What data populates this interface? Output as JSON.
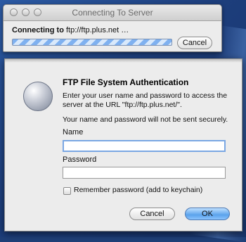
{
  "connecting_window": {
    "title": "Connecting To Server",
    "status_prefix": "Connecting to",
    "status_url": "ftp://ftp.plus.net …",
    "cancel_label": "Cancel"
  },
  "auth_dialog": {
    "title": "FTP File System Authentication",
    "description": "Enter your user name and password to access the server at the URL \"ftp://ftp.plus.net/\".",
    "warning": "Your name and password will not be sent securely.",
    "name_label": "Name",
    "name_value": "",
    "password_label": "Password",
    "password_value": "",
    "remember_label": "Remember password (add to keychain)",
    "cancel_label": "Cancel",
    "ok_label": "OK"
  }
}
